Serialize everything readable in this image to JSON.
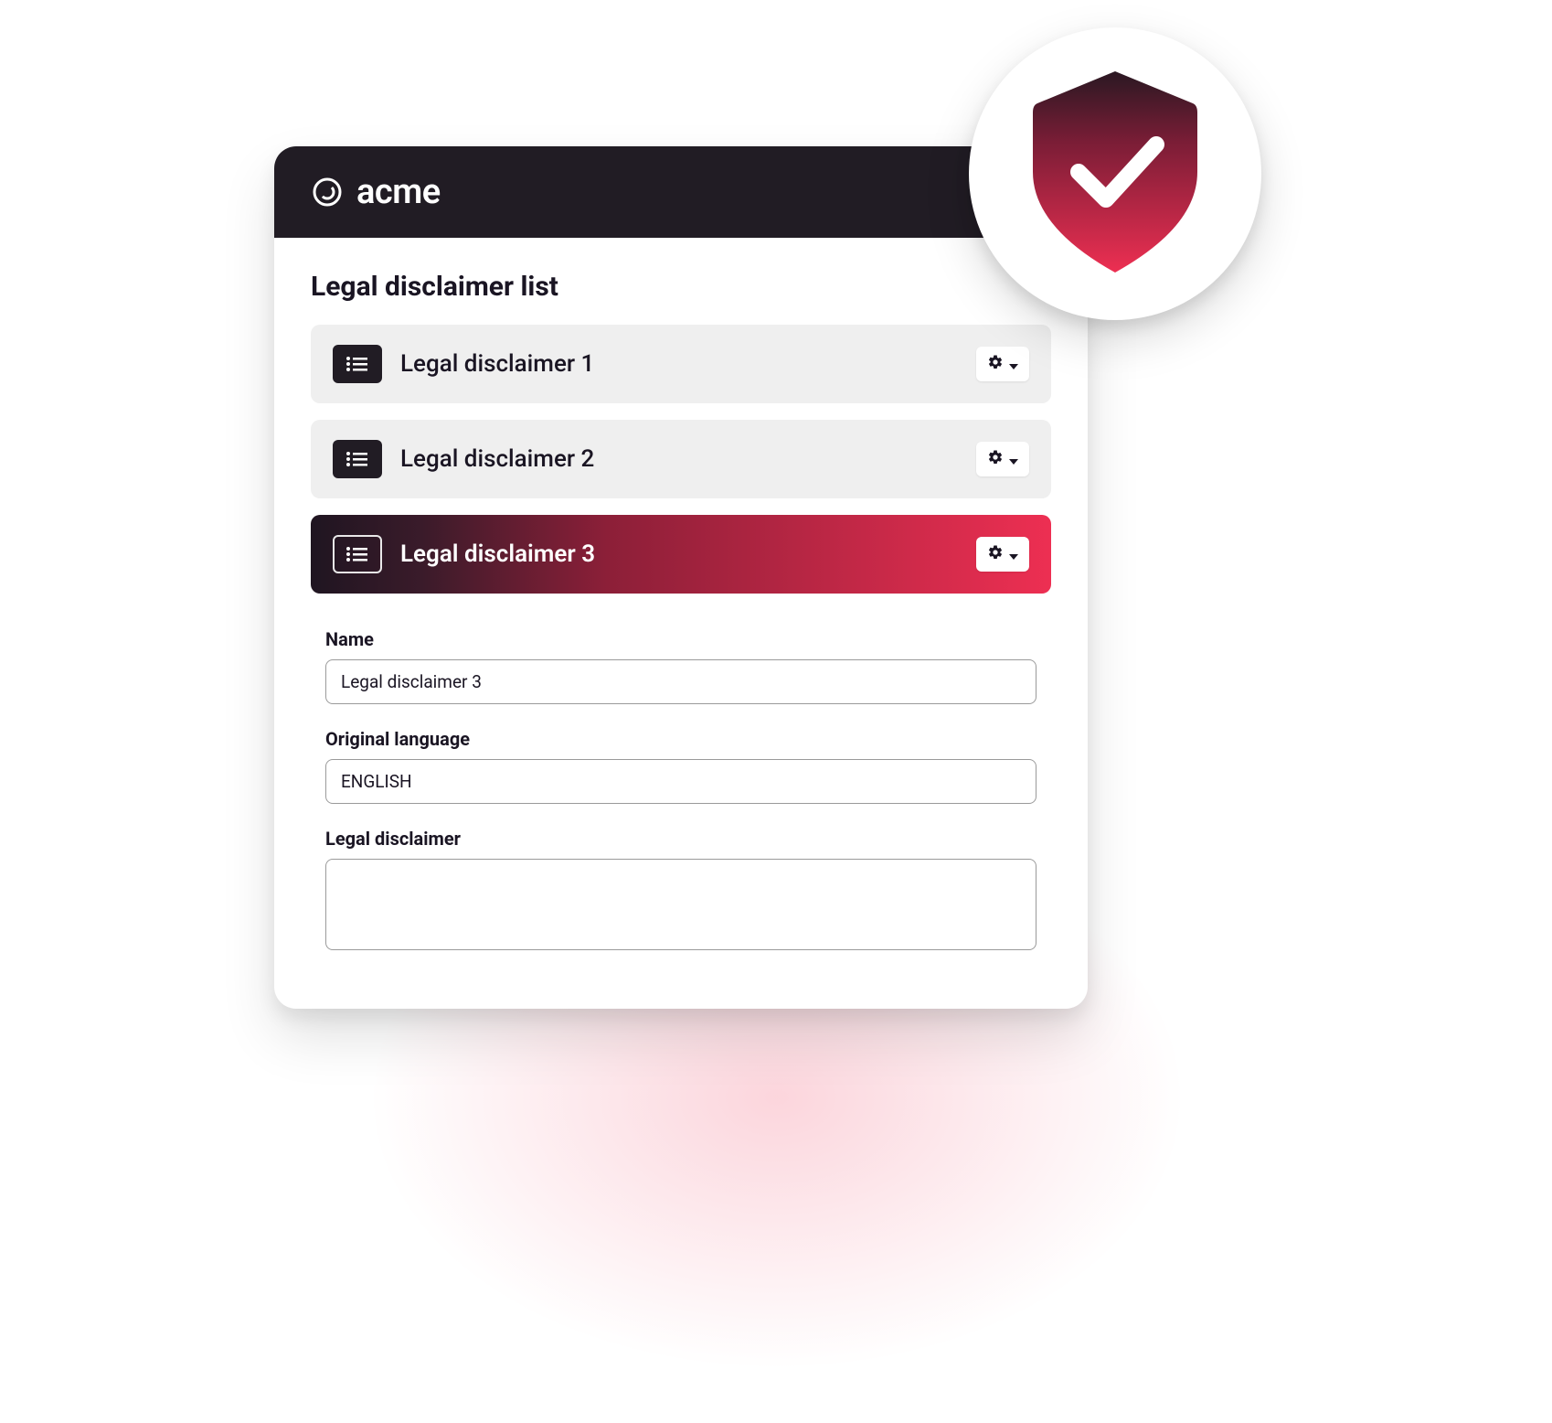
{
  "brand": {
    "name": "acme"
  },
  "page": {
    "title": "Legal disclaimer list"
  },
  "disclaimers": [
    {
      "label": "Legal disclaimer 1",
      "active": false
    },
    {
      "label": "Legal disclaimer 2",
      "active": false
    },
    {
      "label": "Legal disclaimer 3",
      "active": true
    }
  ],
  "form": {
    "name_label": "Name",
    "name_value": "Legal disclaimer 3",
    "language_label": "Original language",
    "language_value": "ENGLISH",
    "disclaimer_label": "Legal disclaimer",
    "disclaimer_value": ""
  }
}
